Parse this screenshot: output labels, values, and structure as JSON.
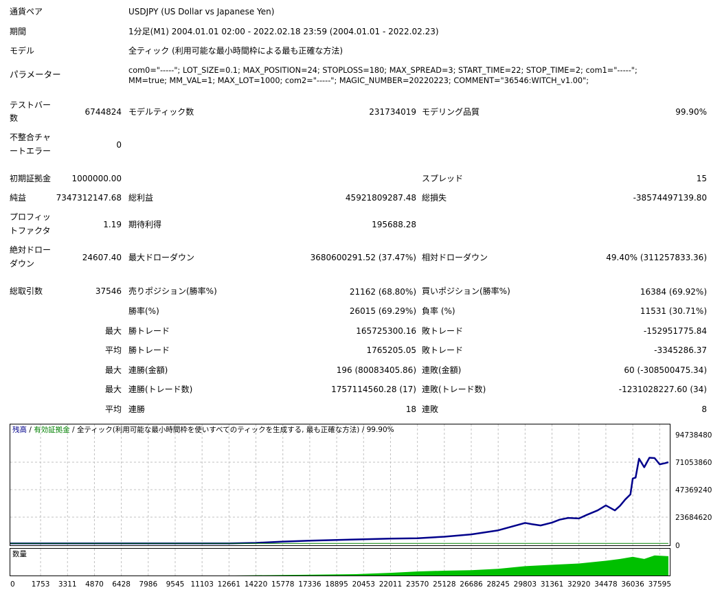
{
  "info": {
    "pair_label": "通貨ペア",
    "pair_value": "USDJPY (US Dollar vs Japanese Yen)",
    "period_label": "期間",
    "period_value": "1分足(M1) 2004.01.01 02:00 - 2022.02.18 23:59 (2004.01.01 - 2022.02.23)",
    "model_label": "モデル",
    "model_value": "全ティック (利用可能な最小時間枠による最も正確な方法)",
    "params_label": "パラメーター",
    "params_line1": "com0=\"-----\"; LOT_SIZE=0.1; MAX_POSITION=24; STOPLOSS=180; MAX_SPREAD=3; START_TIME=22; STOP_TIME=2; com1=\"-----\";",
    "params_line2": "MM=true; MM_VAL=1; MAX_LOT=1000; com2=\"-----\"; MAGIC_NUMBER=20220223; COMMENT=\"36546:WITCH_v1.00\";"
  },
  "stats": {
    "bars_label_1": "テストバー",
    "bars_label_2": "数",
    "bars_value": "6744824",
    "ticks_label": "モデルティック数",
    "ticks_value": "231734019",
    "quality_label": "モデリング品質",
    "quality_value": "99.90%",
    "mismatch_label_1": "不整合チャ",
    "mismatch_label_2": "ートエラー",
    "mismatch_value": "0",
    "deposit_label": "初期証拠金",
    "deposit_value": "1000000.00",
    "spread_label": "スプレッド",
    "spread_value": "15",
    "net_label": "純益",
    "net_value": "7347312147.68",
    "gross_profit_label": "総利益",
    "gross_profit_value": "45921809287.48",
    "gross_loss_label": "総損失",
    "gross_loss_value": "-38574497139.80",
    "pf_label_1": "プロフィッ",
    "pf_label_2": "トファクタ",
    "pf_value": "1.19",
    "expected_label": "期待利得",
    "expected_value": "195688.28",
    "abs_dd_label_1": "絶対ドロー",
    "abs_dd_label_2": "ダウン",
    "abs_dd_value": "24607.40",
    "max_dd_label": "最大ドローダウン",
    "max_dd_value": "3680600291.52 (37.47%)",
    "rel_dd_label": "相対ドローダウン",
    "rel_dd_value": "49.40% (311257833.36)",
    "total_trades_label": "総取引数",
    "total_trades_value": "37546",
    "short_label": "売りポジション(勝率%)",
    "short_value": "21162 (68.80%)",
    "long_label": "買いポジション(勝率%)",
    "long_value": "16384 (69.92%)",
    "win_label": "勝率(%)",
    "win_value": "26015 (69.29%)",
    "loss_label": "負率 (%)",
    "loss_value": "11531 (30.71%)",
    "max_label": "最大",
    "avg_label": "平均",
    "win_trade_label": "勝トレード",
    "loss_trade_label": "敗トレード",
    "max_win_value": "165725300.16",
    "max_loss_value": "-152951775.84",
    "avg_win_value": "1765205.05",
    "avg_loss_value": "-3345286.37",
    "consec_win_amt_label": "連勝(金額)",
    "consec_win_amt_value": "196 (80083405.86)",
    "consec_loss_amt_label": "連敗(金額)",
    "consec_loss_amt_value": "60 (-308500475.34)",
    "consec_win_cnt_label": "連勝(トレード数)",
    "consec_win_cnt_value": "1757114560.28 (17)",
    "consec_loss_cnt_label": "連敗(トレード数)",
    "consec_loss_cnt_value": "-1231028227.60 (34)",
    "avg_consec_win_label": "連勝",
    "avg_consec_win_value": "18",
    "avg_consec_loss_label": "連敗",
    "avg_consec_loss_value": "8"
  },
  "chart_header": {
    "balance": "残高",
    "sep1": " / ",
    "equity": "有効証拠金",
    "sep2": " / ",
    "rest": "全ティック(利用可能な最小時間枠を使いすべてのティックを生成する, 最も正確な方法) / 99.90%"
  },
  "volume_label": "数量",
  "colors": {
    "balance": "#00008b",
    "equity": "#008000",
    "volume": "#00c000",
    "grid": "#c0c0c0"
  },
  "chart_data": {
    "type": "line",
    "title": "",
    "xlabel": "",
    "ylabel": "",
    "ylim": [
      0,
      94738480
    ],
    "y_ticks": [
      "94738480",
      "71053860",
      "47369240",
      "23684620",
      "0"
    ],
    "x_ticks": [
      "0",
      "1753",
      "3311",
      "4870",
      "6428",
      "7986",
      "9545",
      "11103",
      "12661",
      "14220",
      "15778",
      "17336",
      "18895",
      "20453",
      "22011",
      "23570",
      "25128",
      "26686",
      "28245",
      "29803",
      "31361",
      "32920",
      "34478",
      "36036",
      "37595"
    ],
    "grid": true,
    "series": [
      {
        "name": "残高",
        "x": [
          0,
          1753,
          3311,
          4870,
          6428,
          7986,
          9545,
          11103,
          12661,
          14220,
          15778,
          17336,
          18895,
          20453,
          22011,
          23570,
          25128,
          26686,
          28245,
          29803,
          30200,
          30700,
          31361,
          31800,
          32300,
          32920,
          33400,
          34000,
          34478,
          35000,
          35300,
          35600,
          35900,
          36036,
          36200,
          36400,
          36700,
          37000,
          37300,
          37595,
          37900,
          38100
        ],
        "y": [
          1000000,
          1000000,
          1000000,
          1000000,
          1000000,
          1000000,
          1000000,
          1000000,
          1000000,
          1500000,
          2600000,
          3400000,
          4000000,
          4600000,
          5200000,
          5500000,
          6800000,
          8800000,
          12300000,
          18700000,
          17600000,
          16500000,
          19000000,
          21500000,
          23000000,
          22600000,
          25800000,
          29500000,
          33800000,
          29500000,
          33500000,
          38900000,
          43300000,
          57000000,
          57800000,
          74100000,
          66700000,
          74900000,
          74600000,
          69200000,
          70200000,
          71053860
        ]
      },
      {
        "name": "有効証拠金",
        "x": [
          0,
          38100
        ],
        "y": [
          1000000,
          1000000
        ]
      }
    ],
    "volume": {
      "x": [
        0,
        13000,
        20000,
        22000,
        23570,
        25128,
        26686,
        28245,
        29803,
        31361,
        32920,
        34478,
        35300,
        36036,
        36700,
        37300,
        38100
      ],
      "y": [
        0,
        0,
        0.05,
        0.1,
        0.15,
        0.18,
        0.2,
        0.25,
        0.35,
        0.4,
        0.45,
        0.55,
        0.62,
        0.7,
        0.62,
        0.75,
        0.72
      ]
    }
  }
}
